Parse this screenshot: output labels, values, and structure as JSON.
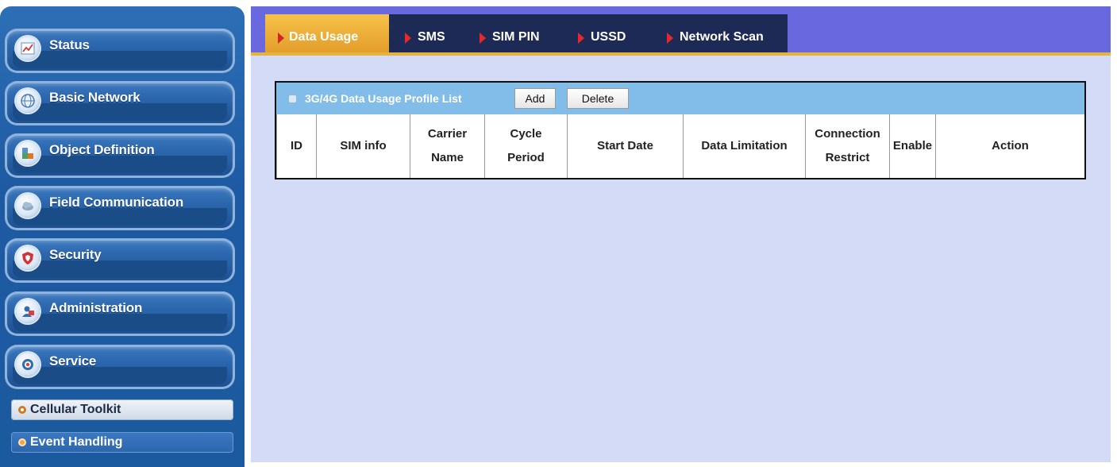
{
  "sidebar": {
    "items": [
      {
        "label": "Status",
        "icon": "chart-icon"
      },
      {
        "label": "Basic Network",
        "icon": "globe-icon"
      },
      {
        "label": "Object Definition",
        "icon": "objects-icon"
      },
      {
        "label": "Field Communication",
        "icon": "cloud-icon"
      },
      {
        "label": "Security",
        "icon": "shield-icon"
      },
      {
        "label": "Administration",
        "icon": "admin-user-icon"
      },
      {
        "label": "Service",
        "icon": "service-icon"
      }
    ],
    "subitems": [
      {
        "label": "Cellular Toolkit",
        "selected": true
      },
      {
        "label": "Event Handling",
        "selected": false
      }
    ]
  },
  "tabs": [
    {
      "label": "Data Usage",
      "active": true
    },
    {
      "label": "SMS",
      "active": false
    },
    {
      "label": "SIM PIN",
      "active": false
    },
    {
      "label": "USSD",
      "active": false
    },
    {
      "label": "Network Scan",
      "active": false
    }
  ],
  "table": {
    "title": "3G/4G Data Usage Profile List",
    "add_label": "Add",
    "delete_label": "Delete",
    "columns": [
      {
        "line1": "ID",
        "line2": ""
      },
      {
        "line1": "SIM info",
        "line2": ""
      },
      {
        "line1": "Carrier",
        "line2": "Name"
      },
      {
        "line1": "Cycle",
        "line2": "Period"
      },
      {
        "line1": "Start Date",
        "line2": ""
      },
      {
        "line1": "Data Limitation",
        "line2": ""
      },
      {
        "line1": "Connection",
        "line2": "Restrict"
      },
      {
        "line1": "Enable",
        "line2": ""
      },
      {
        "line1": "Action",
        "line2": ""
      }
    ]
  },
  "colors": {
    "sidebar_blue": "#1d5aa2",
    "tab_active": "#f0b03a",
    "tab_strip": "#1e2a56",
    "tab_bar": "#6a68df",
    "content_bg": "#d4dbf6",
    "table_header": "#82bde9"
  }
}
